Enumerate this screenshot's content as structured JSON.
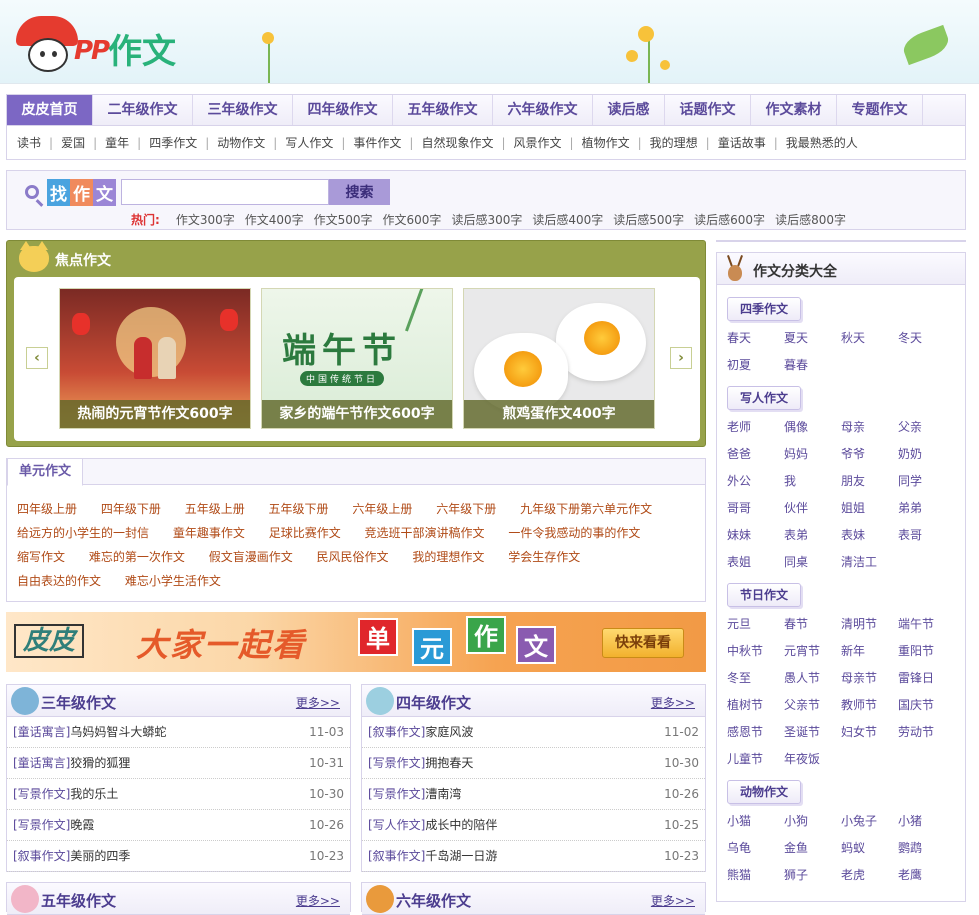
{
  "header": {
    "logo_pp": "PP",
    "logo_text": "作文"
  },
  "nav": {
    "items": [
      "皮皮首页",
      "二年级作文",
      "三年级作文",
      "四年级作文",
      "五年级作文",
      "六年级作文",
      "读后感",
      "话题作文",
      "作文素材",
      "专题作文"
    ],
    "active": "皮皮首页"
  },
  "subnav": {
    "items": [
      "读书",
      "爱国",
      "童年",
      "四季作文",
      "动物作文",
      "写人作文",
      "事件作文",
      "自然现象作文",
      "风景作文",
      "植物作文",
      "我的理想",
      "童话故事",
      "我最熟悉的人"
    ]
  },
  "search": {
    "logo_chars": [
      "找",
      "作",
      "文"
    ],
    "placeholder": "",
    "button_label": "搜索",
    "hot_label": "热门:",
    "hot_items": [
      "作文300字",
      "作文400字",
      "作文500字",
      "作文600字",
      "读后感300字",
      "读后感400字",
      "读后感500字",
      "读后感600字",
      "读后感800字"
    ]
  },
  "focus": {
    "title": "焦点作文",
    "prev": "‹",
    "next": "›",
    "slides": [
      {
        "caption": "热闹的元宵节作文600字",
        "image_text": ""
      },
      {
        "caption": "家乡的端午节作文600字",
        "image_text": "端午节",
        "image_subtext": "中国传统节日"
      },
      {
        "caption": "煎鸡蛋作文400字",
        "image_text": ""
      }
    ]
  },
  "unit": {
    "tab": "单元作文",
    "rows": [
      [
        "四年级上册",
        "四年级下册",
        "五年级上册",
        "五年级下册",
        "六年级上册",
        "六年级下册",
        "九年级下册第六单元作文"
      ],
      [
        "给远方的小学生的一封信",
        "童年趣事作文",
        "足球比赛作文",
        "竞选班干部演讲稿作文",
        "一件令我感动的事的作文"
      ],
      [
        "缩写作文",
        "难忘的第一次作文",
        "假文盲漫画作文",
        "民风民俗作文",
        "我的理想作文",
        "学会生存作文"
      ],
      [
        "自由表达的作文",
        "难忘小学生活作文"
      ]
    ]
  },
  "banner": {
    "brand": "皮皮",
    "slogan": "大家一起看",
    "chars": [
      "单",
      "元",
      "作",
      "文"
    ],
    "button": "快来看看"
  },
  "columns": [
    {
      "title": "三年级作文",
      "more": "更多>>",
      "items": [
        {
          "tag": "[童话寓言]",
          "title": "乌妈妈智斗大蟒蛇",
          "date": "11-03"
        },
        {
          "tag": "[童话寓言]",
          "title": "狡猾的狐狸",
          "date": "10-31"
        },
        {
          "tag": "[写景作文]",
          "title": "我的乐土",
          "date": "10-30"
        },
        {
          "tag": "[写景作文]",
          "title": "晚霞",
          "date": "10-26"
        },
        {
          "tag": "[叙事作文]",
          "title": "美丽的四季",
          "date": "10-23"
        }
      ]
    },
    {
      "title": "四年级作文",
      "more": "更多>>",
      "items": [
        {
          "tag": "[叙事作文]",
          "title": "家庭风波",
          "date": "11-02"
        },
        {
          "tag": "[写景作文]",
          "title": "拥抱春天",
          "date": "10-30"
        },
        {
          "tag": "[写景作文]",
          "title": "漕南湾",
          "date": "10-26"
        },
        {
          "tag": "[写人作文]",
          "title": "成长中的陪伴",
          "date": "10-25"
        },
        {
          "tag": "[叙事作文]",
          "title": "千岛湖一日游",
          "date": "10-23"
        }
      ]
    },
    {
      "title": "五年级作文",
      "more": "更多>>",
      "items": []
    },
    {
      "title": "六年级作文",
      "more": "更多>>",
      "items": []
    }
  ],
  "sidebar": {
    "title": "作文分类大全",
    "categories": [
      {
        "name": "四季作文",
        "items": [
          "春天",
          "夏天",
          "秋天",
          "冬天",
          "初夏",
          "暮春"
        ]
      },
      {
        "name": "写人作文",
        "items": [
          "老师",
          "偶像",
          "母亲",
          "父亲",
          "爸爸",
          "妈妈",
          "爷爷",
          "奶奶",
          "外公",
          "我",
          "朋友",
          "同学",
          "哥哥",
          "伙伴",
          "姐姐",
          "弟弟",
          "妹妹",
          "表弟",
          "表妹",
          "表哥",
          "表姐",
          "同桌",
          "清洁工"
        ]
      },
      {
        "name": "节日作文",
        "items": [
          "元旦",
          "春节",
          "清明节",
          "端午节",
          "中秋节",
          "元宵节",
          "新年",
          "重阳节",
          "冬至",
          "愚人节",
          "母亲节",
          "雷锋日",
          "植树节",
          "父亲节",
          "教师节",
          "国庆节",
          "感恩节",
          "圣诞节",
          "妇女节",
          "劳动节",
          "儿童节",
          "年夜饭"
        ]
      },
      {
        "name": "动物作文",
        "items": [
          "小猫",
          "小狗",
          "小兔子",
          "小猪",
          "乌龟",
          "金鱼",
          "蚂蚁",
          "鹦鹉",
          "熊猫",
          "狮子",
          "老虎",
          "老鹰"
        ]
      }
    ]
  },
  "colors": {
    "accent": "#7c67c4",
    "focus_bg": "#97a24a",
    "link_orange": "#b04a16"
  }
}
